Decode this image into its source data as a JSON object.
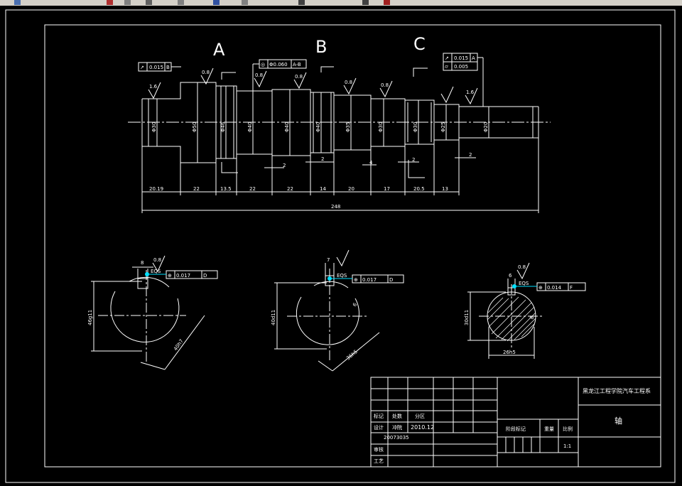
{
  "view_labels": {
    "a": "A",
    "b": "B",
    "c": "C"
  },
  "roughness": {
    "r1": "1.6",
    "r2": "0.8",
    "r3": "0.8",
    "r4": "0.8",
    "r5": "0.8",
    "r6": "0.8",
    "r7": "1.6",
    "r8": "0.8",
    "r9": "0.8"
  },
  "tolerances": {
    "runout_left": "0.015",
    "runout_left_datum": "B",
    "coax_value": "Φ0.060",
    "coax_datum": "A-B",
    "runout_right": "0.015",
    "runout_right_datum": "A",
    "cyl_value": "0.005",
    "pos_1": "0.017",
    "pos_1_datum": "D",
    "pos_2": "0.017",
    "pos_2_datum": "D",
    "pos_3": "0.014",
    "pos_3_datum": "F",
    "eqs": "EQS",
    "mmc": "M"
  },
  "diameters": [
    "Φ30",
    "Φ50",
    "Φ46",
    "Φ40",
    "Φ40",
    "Φ40",
    "Φ35",
    "Φ30",
    "Φ30",
    "Φ25",
    "Φ20"
  ],
  "lengths": [
    "20.19",
    "22",
    "13.5",
    "22",
    "22",
    "14",
    "20",
    "17",
    "20.5",
    "13"
  ],
  "small_dims": [
    "2",
    "2",
    "4",
    "2",
    "2"
  ],
  "overall_length": "248",
  "sections": {
    "s1": {
      "key": "8",
      "height": "46g11",
      "diag": "40h7"
    },
    "s2": {
      "key": "7",
      "height": "40d11",
      "diag": "36h5",
      "chamfer": "6"
    },
    "s3": {
      "key": "6",
      "height": "30d11",
      "width": "26h5",
      "chamfer": "8"
    }
  },
  "title_block": {
    "school": "黑龙江工程学院汽车工程系",
    "part_name": "轴",
    "mark": "标记",
    "count": "处数",
    "zone": "分区",
    "design": "设计",
    "designer": "冲院",
    "date": "2010.12",
    "student_no": "20073035",
    "review": "审核",
    "process": "工艺",
    "stage_mark": "阶段标记",
    "weight": "重量",
    "scale": "比例",
    "scale_value": "1:1"
  },
  "colors": {
    "background": "#000000",
    "lines": "#ffffff",
    "accent": "#00e0ff",
    "toolbar": "#d4d0c8"
  }
}
